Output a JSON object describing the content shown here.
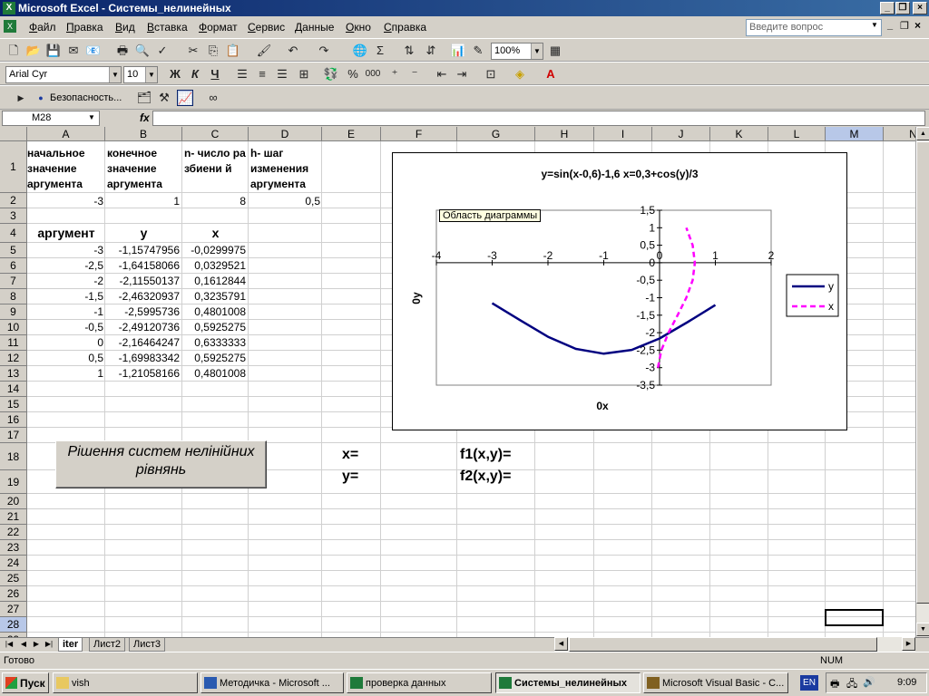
{
  "window": {
    "title": "Microsoft Excel - Системы_нелинейных",
    "app_icon": "excel-icon",
    "minimize": "_",
    "restore": "❐",
    "close": "×"
  },
  "menu": {
    "items": [
      "Файл",
      "Правка",
      "Вид",
      "Вставка",
      "Формат",
      "Сервис",
      "Данные",
      "Окно",
      "Справка"
    ],
    "ask_placeholder": "Введите вопрос"
  },
  "toolbar": {
    "zoom": "100%",
    "font": "Arial Cyr",
    "size": "10",
    "bold": "Ж",
    "italic": "К",
    "underline": "Ч",
    "security": "Безопасность...",
    "percent": "%",
    "thousands": "000",
    "autosum": "Σ"
  },
  "formula_bar": {
    "name_box": "M28",
    "fx": "fx",
    "content": ""
  },
  "columns": [
    "A",
    "B",
    "C",
    "D",
    "E",
    "F",
    "G",
    "H",
    "I",
    "J",
    "K",
    "L",
    "M",
    "N"
  ],
  "rows": [
    "1",
    "2",
    "3",
    "4",
    "5",
    "6",
    "7",
    "8",
    "9",
    "10",
    "11",
    "12",
    "13",
    "14",
    "15",
    "16",
    "17",
    "18",
    "19",
    "20",
    "21",
    "22",
    "23",
    "24",
    "25",
    "26",
    "27",
    "28",
    "29"
  ],
  "headers_row1": {
    "A": "начальное значение аргумента",
    "B": "конечное значение аргумента",
    "C": "n- число разбиени й",
    "D": "h- шаг изменения аргумента"
  },
  "row2": {
    "A": "-3",
    "B": "1",
    "C": "8",
    "D": "0,5"
  },
  "row4": {
    "A": "аргумент",
    "B": "y",
    "C": "x"
  },
  "table": [
    {
      "a": "-3",
      "y": "-1,15747956",
      "x": "-0,0299975"
    },
    {
      "a": "-2,5",
      "y": "-1,64158066",
      "x": "0,0329521"
    },
    {
      "a": "-2",
      "y": "-2,11550137",
      "x": "0,1612844"
    },
    {
      "a": "-1,5",
      "y": "-2,46320937",
      "x": "0,3235791"
    },
    {
      "a": "-1",
      "y": "-2,5995736",
      "x": "0,4801008"
    },
    {
      "a": "-0,5",
      "y": "-2,49120736",
      "x": "0,5925275"
    },
    {
      "a": "0",
      "y": "-2,16464247",
      "x": "0,6333333"
    },
    {
      "a": "0,5",
      "y": "-1,69983342",
      "x": "0,5925275"
    },
    {
      "a": "1",
      "y": "-1,21058166",
      "x": "0,4801008"
    }
  ],
  "solve_button": "Рішення систем нелінійних рівнянь",
  "labels": {
    "x": "x=",
    "y": "y=",
    "f1": "f1(x,y)=",
    "f2": "f2(x,y)="
  },
  "chart_data": {
    "type": "scatter",
    "title": "y=sin(x-0,6)-1,6      x=0,3+cos(y)/3",
    "tooltip": "Область диаграммы",
    "xlabel": "0x",
    "ylabel": "0y",
    "xlim": [
      -4,
      2
    ],
    "ylim": [
      -3.5,
      1.5
    ],
    "xticks": [
      "-4",
      "-3",
      "-2",
      "-1",
      "0",
      "1",
      "2"
    ],
    "yticks": [
      "1,5",
      "1",
      "0,5",
      "0",
      "-0,5",
      "-1",
      "-1,5",
      "-2",
      "-2,5",
      "-3",
      "-3,5"
    ],
    "legend_position": "right",
    "series": [
      {
        "name": "y",
        "color": "#000080",
        "style": "solid",
        "x": [
          -3,
          -2.5,
          -2,
          -1.5,
          -1,
          -0.5,
          0,
          0.5,
          1
        ],
        "y": [
          -1.157,
          -1.642,
          -2.116,
          -2.463,
          -2.6,
          -2.491,
          -2.165,
          -1.7,
          -1.211
        ]
      },
      {
        "name": "x",
        "color": "#ff00ff",
        "style": "dashed",
        "x": [
          -0.03,
          0.033,
          0.161,
          0.324,
          0.48,
          0.593,
          0.633,
          0.593,
          0.48
        ],
        "y": [
          -3,
          -2.5,
          -2,
          -1.5,
          -1,
          -0.5,
          0,
          0.5,
          1
        ]
      }
    ]
  },
  "sheet_tabs": [
    "iter",
    "Лист2",
    "Лист3"
  ],
  "status": {
    "left": "Готово",
    "num": "NUM"
  },
  "taskbar": {
    "start": "Пуск",
    "tasks": [
      "vish",
      "Методичка - Microsoft ...",
      "проверка данных",
      "Системы_нелинейных",
      "Microsoft Visual Basic - С..."
    ],
    "lang": "EN",
    "time": "9:09"
  }
}
